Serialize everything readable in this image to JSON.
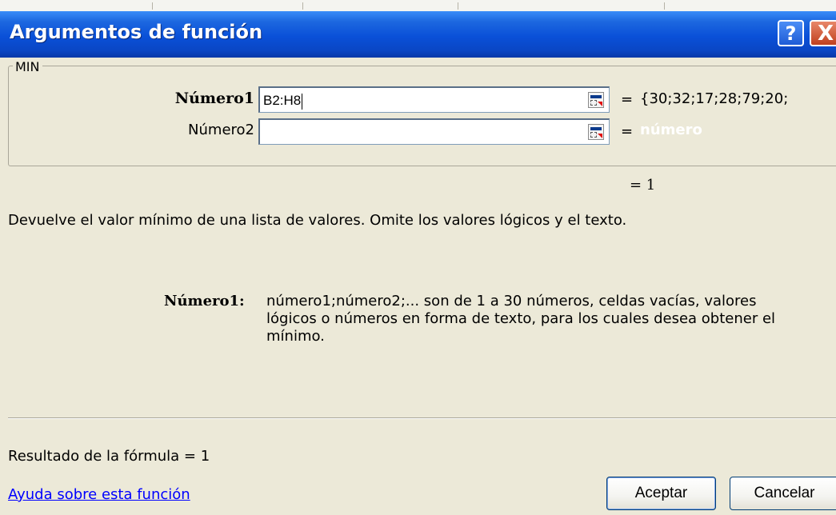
{
  "window": {
    "title": "Argumentos de función",
    "help_button": "?",
    "close_button": "X"
  },
  "function_group": {
    "name": "MIN",
    "arguments": [
      {
        "label": "Número1",
        "value": "B2:H8",
        "equals": "=",
        "result": "{30;32;17;28;79;20;"
      },
      {
        "label": "Número2",
        "value": "",
        "equals": "=",
        "result": "número"
      }
    ]
  },
  "function_result": "= 1",
  "description": "Devuelve el valor mínimo de una lista de valores. Omite los valores lógicos y el texto.",
  "argument_help": {
    "label": "Número1:",
    "text": "número1;número2;... son de 1 a 30 números, celdas vacías, valores lógicos o números en forma de texto, para los cuales desea obtener el mínimo."
  },
  "formula_result": "Resultado de la fórmula =  1",
  "help_link": "Ayuda sobre esta función",
  "buttons": {
    "ok": "Aceptar",
    "cancel": "Cancelar"
  },
  "icons": {
    "collapse": "collapse-dialog-icon"
  },
  "colors": {
    "titlebar": "#0A50D8",
    "link": "#0000FF",
    "background": "#ECE9D8"
  }
}
